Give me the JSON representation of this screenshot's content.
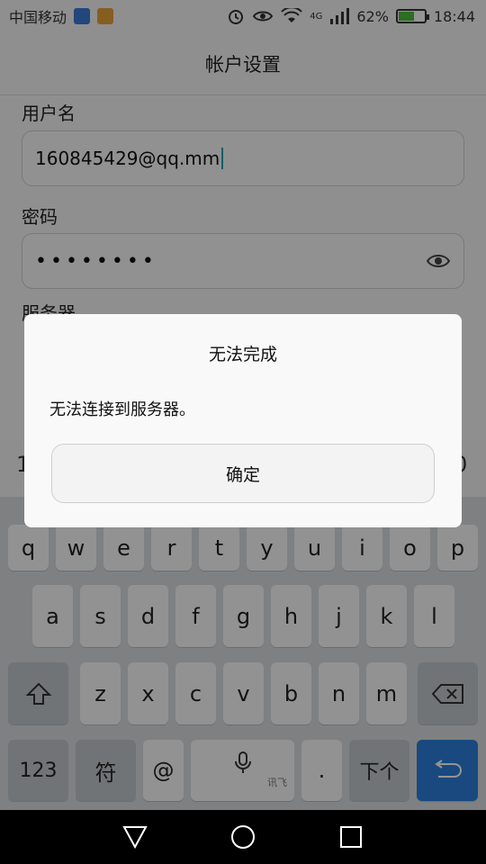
{
  "status_bar": {
    "carrier": "中国移动",
    "network": "4G",
    "battery_percent": "62%",
    "battery_level": 0.62,
    "time": "18:44",
    "icons": [
      "wifi-hotspot-icon",
      "keyboard-notify-icon",
      "alarm-icon",
      "eye-icon",
      "wifi-icon",
      "signal-icon",
      "battery-icon"
    ]
  },
  "header": {
    "title": "帐户设置"
  },
  "form": {
    "username_label": "用户名",
    "username_value": "160845429@qq.mm",
    "password_label": "密码",
    "password_value": "••••••••",
    "server_label": "服务器"
  },
  "candidate_row": {
    "left": "1",
    "right": "0"
  },
  "keyboard": {
    "row1": [
      "q",
      "w",
      "e",
      "r",
      "t",
      "y",
      "u",
      "i",
      "o",
      "p"
    ],
    "row2": [
      "a",
      "s",
      "d",
      "f",
      "g",
      "h",
      "j",
      "k",
      "l"
    ],
    "row3": [
      "z",
      "x",
      "c",
      "v",
      "b",
      "n",
      "m"
    ],
    "num": "123",
    "symbols": "符",
    "at": "@",
    "space_hint": "讯飞",
    "dot": ".",
    "next": "下个"
  },
  "dialog": {
    "title": "无法完成",
    "message": "无法连接到服务器。",
    "confirm": "确定"
  },
  "colors": {
    "accent_blue": "#2b7fd9",
    "battery_green": "#4cbe3b",
    "caret": "#1aa2b8"
  }
}
